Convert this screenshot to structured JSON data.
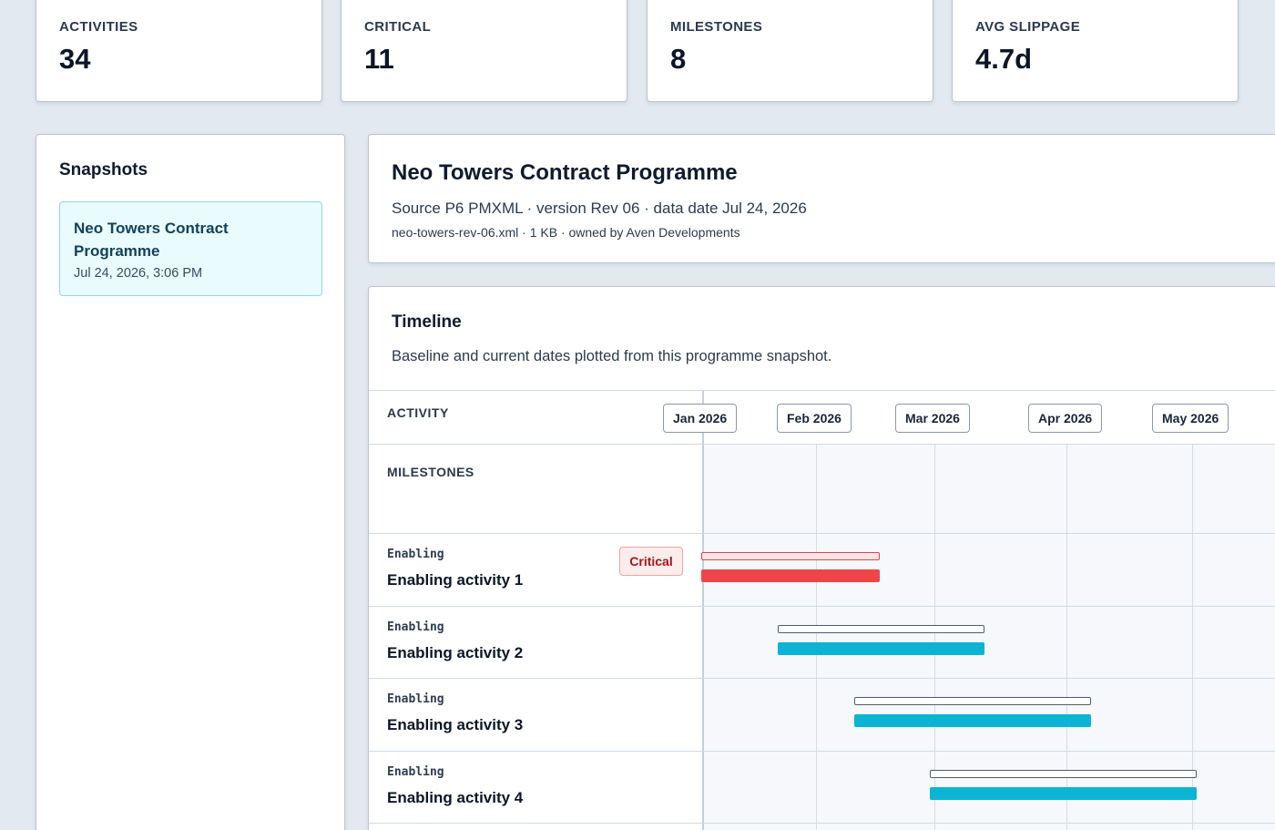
{
  "stats": [
    {
      "label": "ACTIVITIES",
      "value": "34"
    },
    {
      "label": "CRITICAL",
      "value": "11"
    },
    {
      "label": "MILESTONES",
      "value": "8"
    },
    {
      "label": "AVG SLIPPAGE",
      "value": "4.7d"
    }
  ],
  "snapshots": {
    "title": "Snapshots",
    "items": [
      {
        "name": "Neo Towers Contract Programme",
        "date": "Jul 24, 2026, 3:06 PM"
      }
    ]
  },
  "programme": {
    "title": "Neo Towers Contract Programme",
    "source": "Source P6 PMXML · version Rev 06 · data date Jul 24, 2026",
    "meta": "neo-towers-rev-06.xml · 1 KB · owned by Aven Developments"
  },
  "timeline": {
    "title": "Timeline",
    "description": "Baseline and current dates plotted from this programme snapshot.",
    "activity_header": "ACTIVITY",
    "milestones_label": "MILESTONES",
    "months": [
      "Jan 2026",
      "Feb 2026",
      "Mar 2026",
      "Apr 2026",
      "May 2026"
    ],
    "critical_badge": "Critical",
    "colors": {
      "critical": "#ee4549",
      "normal": "#0ab4d4"
    },
    "activities": [
      {
        "category": "Enabling",
        "name": "Enabling activity 1",
        "critical": true,
        "baseline": [
          "2026-01-01",
          "2026-02-17"
        ],
        "current": [
          "2026-01-01",
          "2026-02-17"
        ]
      },
      {
        "category": "Enabling",
        "name": "Enabling activity 2",
        "critical": false,
        "baseline": [
          "2026-01-21",
          "2026-03-17"
        ],
        "current": [
          "2026-01-21",
          "2026-03-17"
        ]
      },
      {
        "category": "Enabling",
        "name": "Enabling activity 3",
        "critical": false,
        "baseline": [
          "2026-02-10",
          "2026-04-14"
        ],
        "current": [
          "2026-02-10",
          "2026-04-14"
        ]
      },
      {
        "category": "Enabling",
        "name": "Enabling activity 4",
        "critical": false,
        "baseline": [
          "2026-03-01",
          "2026-05-01"
        ],
        "current": [
          "2026-03-01",
          "2026-05-01"
        ]
      }
    ]
  }
}
